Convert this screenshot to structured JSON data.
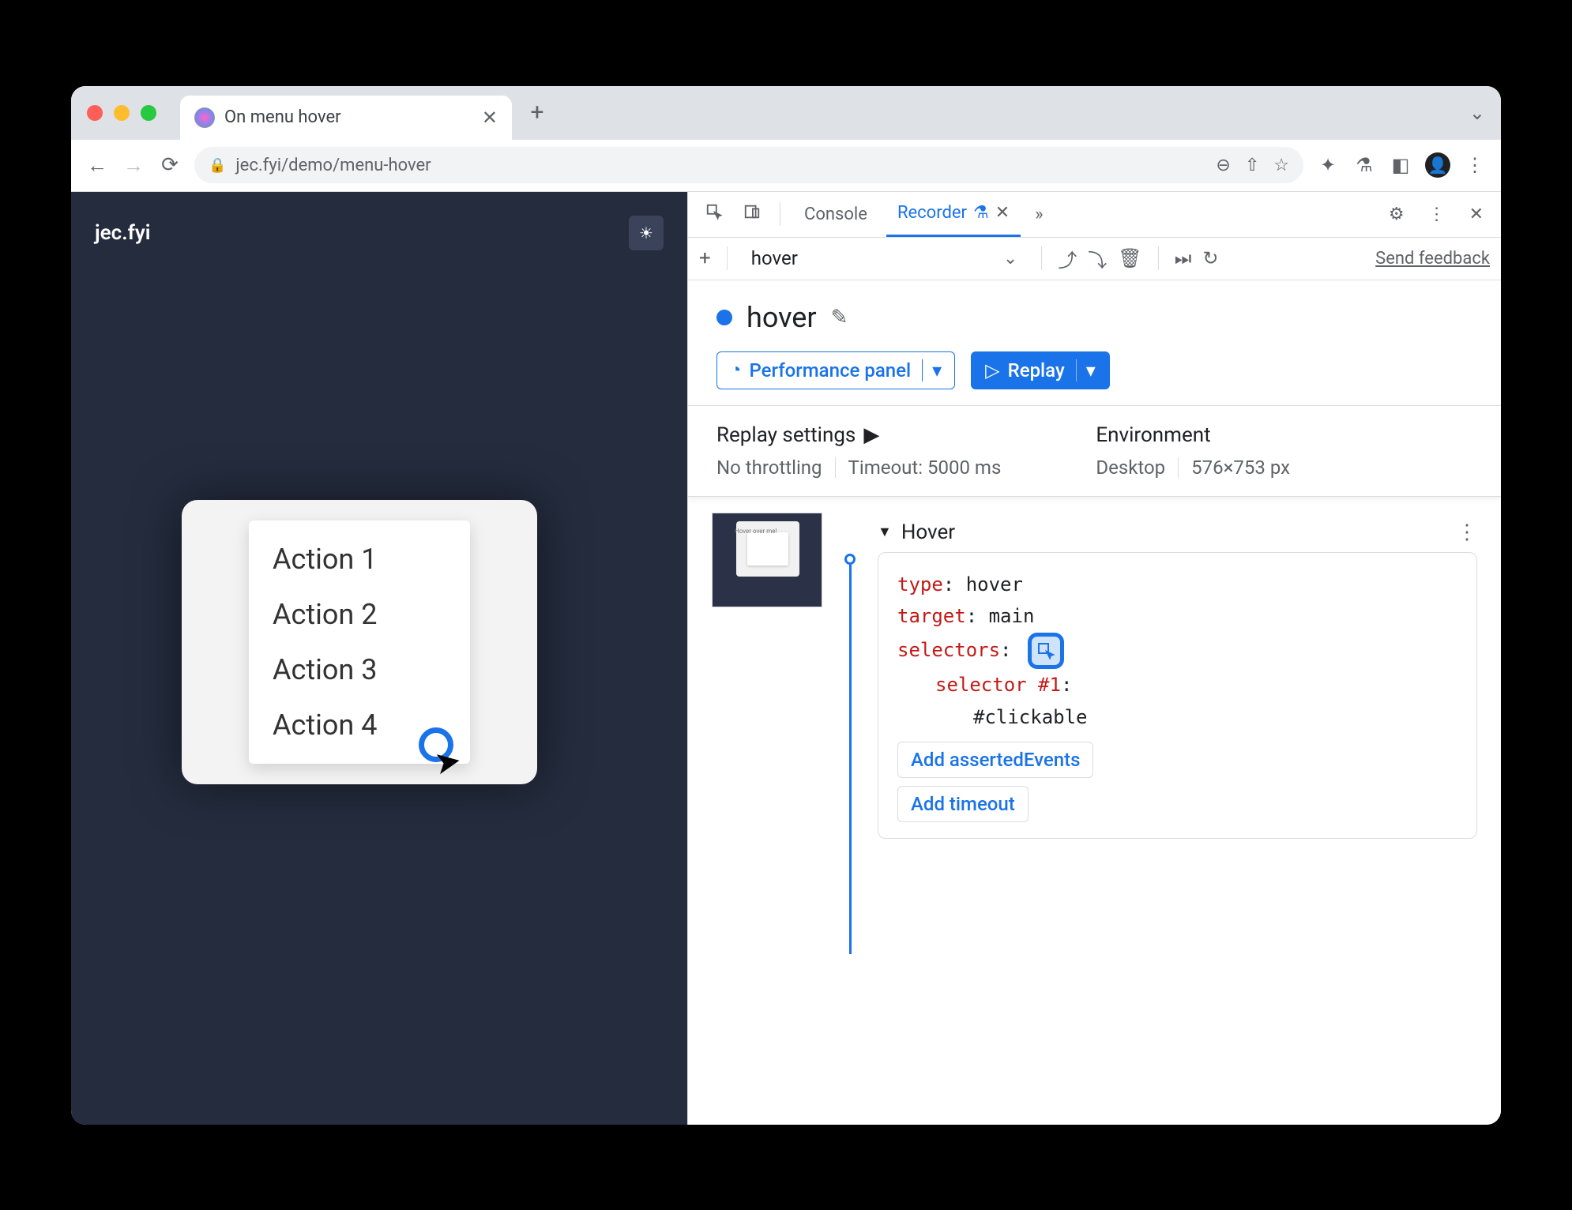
{
  "browser": {
    "tab_title": "On menu hover",
    "url_host": "jec.fyi",
    "url_path": "/demo/menu-hover"
  },
  "page": {
    "site_title": "jec.fyi",
    "hover_hint": "Hover over me!",
    "menu_items": [
      "Action 1",
      "Action 2",
      "Action 3",
      "Action 4"
    ]
  },
  "devtools": {
    "tabs": {
      "console": "Console",
      "recorder": "Recorder"
    },
    "toolbar": {
      "recording_name": "hover",
      "feedback": "Send feedback"
    },
    "recording_title": "hover",
    "perf_button": "Performance panel",
    "replay_button": "Replay",
    "replay_settings": {
      "heading": "Replay settings",
      "throttling": "No throttling",
      "timeout": "Timeout: 5000 ms"
    },
    "environment": {
      "heading": "Environment",
      "device": "Desktop",
      "viewport": "576×753 px"
    },
    "step": {
      "name": "Hover",
      "type_key": "type",
      "type_val": "hover",
      "target_key": "target",
      "target_val": "main",
      "selectors_key": "selectors",
      "selector_label": "selector #1",
      "selector_value": "#clickable",
      "add_asserted": "Add assertedEvents",
      "add_timeout": "Add timeout"
    },
    "thumb_text": "Hover over me!"
  }
}
